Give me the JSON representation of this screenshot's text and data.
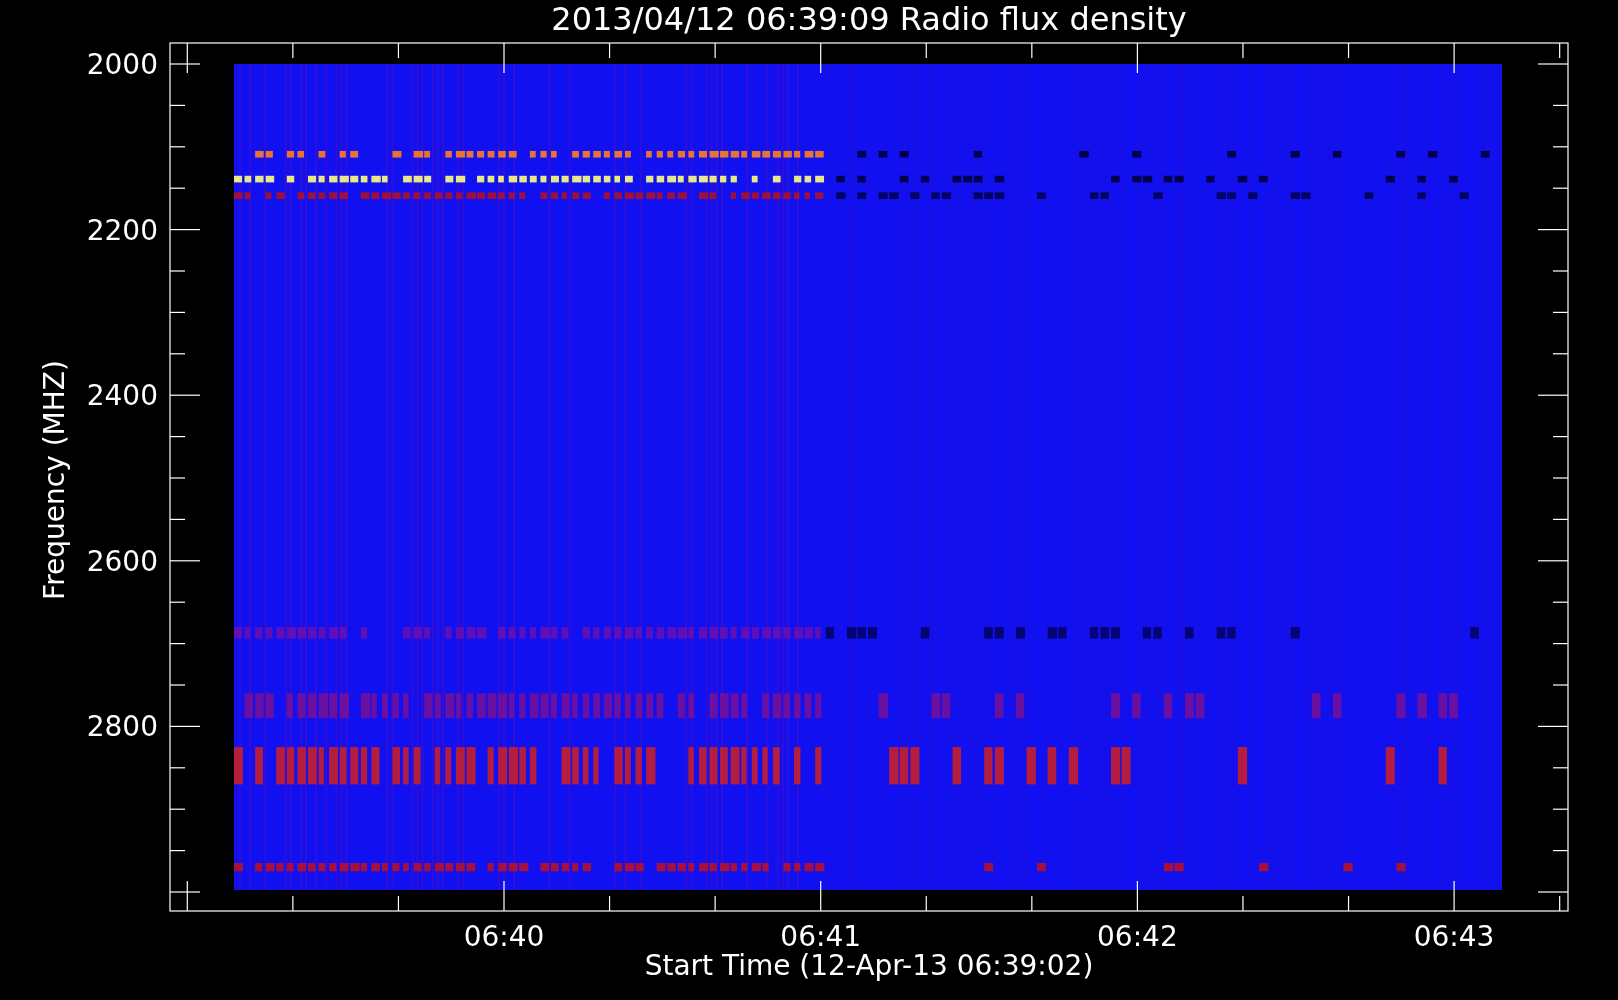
{
  "title": "2013/04/12 06:39:09 Radio flux density",
  "y_axis": {
    "label": "Frequency (MHZ)",
    "ticks": [
      "2000",
      "2200",
      "2400",
      "2600",
      "2800"
    ]
  },
  "x_axis": {
    "label": "Start Time (12-Apr-13 06:39:02)",
    "ticks": [
      "06:40",
      "06:41",
      "06:42",
      "06:43"
    ]
  }
}
